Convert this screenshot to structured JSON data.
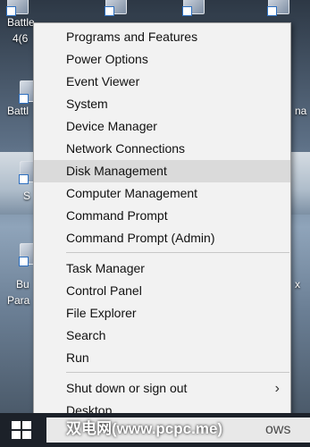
{
  "desktop": {
    "labels": [
      "Battle",
      "4(6",
      "Battl",
      "S",
      "Bu",
      "Para",
      "x",
      "na"
    ]
  },
  "menu": {
    "groups": [
      [
        "Programs and Features",
        "Power Options",
        "Event Viewer",
        "System",
        "Device Manager",
        "Network Connections",
        "Disk Management",
        "Computer Management",
        "Command Prompt",
        "Command Prompt (Admin)"
      ],
      [
        "Task Manager",
        "Control Panel",
        "File Explorer",
        "Search",
        "Run"
      ],
      [
        "Shut down or sign out",
        "Desktop"
      ]
    ],
    "highlighted": "Disk Management",
    "submenu_indicator": "›"
  },
  "taskbar": {
    "search_text": "ows"
  },
  "watermark": "双电网(www.pcpc.me)",
  "colors": {
    "menu_bg": "#f2f2f2",
    "highlight": "#dadada",
    "taskbar": "#1c2129"
  }
}
